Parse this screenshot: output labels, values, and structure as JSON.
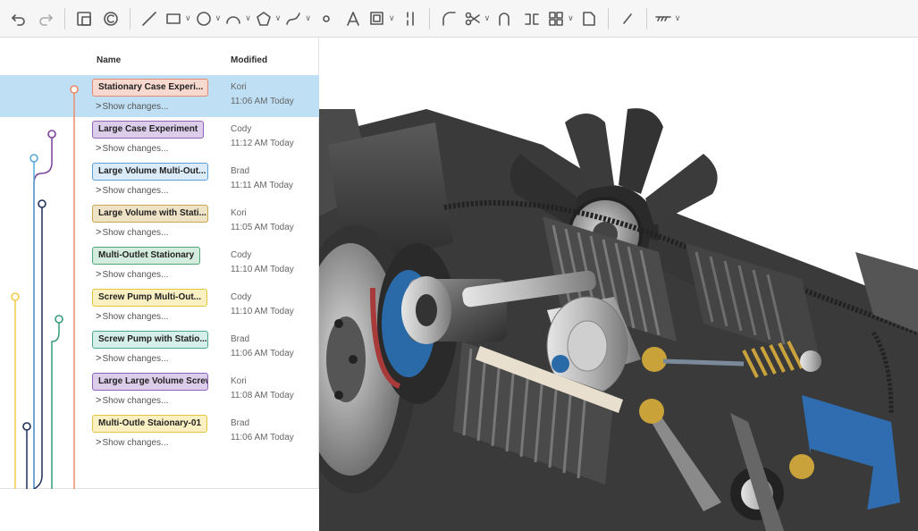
{
  "toolbar": {
    "tools": [
      {
        "icon": "undo-icon"
      },
      {
        "icon": "redo-icon"
      },
      {
        "icon": "sketch-plane-icon"
      },
      {
        "icon": "use-icon"
      },
      {
        "icon": "line-icon"
      },
      {
        "icon": "rectangle-icon"
      },
      {
        "icon": "circle-icon"
      },
      {
        "icon": "arc-icon"
      },
      {
        "icon": "polygon-icon"
      },
      {
        "icon": "spline-icon"
      },
      {
        "icon": "point-icon"
      },
      {
        "icon": "construction-icon"
      },
      {
        "icon": "offset-icon"
      },
      {
        "icon": "mirror-icon"
      },
      {
        "icon": "fillet-icon"
      },
      {
        "icon": "trim-icon"
      },
      {
        "icon": "extend-icon"
      },
      {
        "icon": "split-icon"
      },
      {
        "icon": "pattern-icon"
      },
      {
        "icon": "transform-icon"
      },
      {
        "icon": "dimension-icon"
      },
      {
        "icon": "hatch-icon"
      }
    ]
  },
  "columns": {
    "name": "Name",
    "modified": "Modified"
  },
  "versions": [
    {
      "name": "Stationary Case Experi...",
      "author": "Kori",
      "time": "11:06 AM Today",
      "show": "Show changes...",
      "chip_bg": "#f7d9d0",
      "chip_border": "#e38b72",
      "selected": true
    },
    {
      "name": "Large Case Experiment",
      "author": "Cody",
      "time": "11:12 AM Today",
      "show": "Show changes...",
      "chip_bg": "#dccdeb",
      "chip_border": "#8f64b8",
      "selected": false
    },
    {
      "name": "Large Volume Multi-Out...",
      "author": "Brad",
      "time": "11:11 AM Today",
      "show": "Show changes...",
      "chip_bg": "#dcebf8",
      "chip_border": "#5aa0d8",
      "selected": false
    },
    {
      "name": "Large Volume with Stati...",
      "author": "Kori",
      "time": "11:05 AM Today",
      "show": "Show changes...",
      "chip_bg": "#efe3c6",
      "chip_border": "#c9a650",
      "selected": false
    },
    {
      "name": "Multi-Outlet Stationary",
      "author": "Cody",
      "time": "11:10 AM Today",
      "show": "Show changes...",
      "chip_bg": "#d4ecde",
      "chip_border": "#4fa678",
      "selected": false
    },
    {
      "name": "Screw Pump Multi-Out...",
      "author": "Cody",
      "time": "11:10 AM Today",
      "show": "Show changes...",
      "chip_bg": "#fbf0c2",
      "chip_border": "#e3c43e",
      "selected": false
    },
    {
      "name": "Screw Pump with Statio...",
      "author": "Brad",
      "time": "11:06 AM Today",
      "show": "Show changes...",
      "chip_bg": "#d6efe9",
      "chip_border": "#4aa894",
      "selected": false
    },
    {
      "name": "Large Large Volume Screw",
      "author": "Kori",
      "time": "11:08 AM Today",
      "show": "Show changes...",
      "chip_bg": "#dccdeb",
      "chip_border": "#8f64b8",
      "selected": false
    },
    {
      "name": "Multi-Outle Staionary-01",
      "author": "Brad",
      "time": "11:06 AM Today",
      "show": "Show changes...",
      "chip_bg": "#fbf0c2",
      "chip_border": "#e3c43e",
      "selected": false
    }
  ],
  "graph_colors": {
    "orange": "#ef8a6a",
    "purple": "#7b3f9a",
    "blue": "#59a8d8",
    "navy": "#1f2d5a",
    "yellow": "#f2c94c",
    "green": "#3a9a7a"
  },
  "selection_color": "#bfe0f4"
}
